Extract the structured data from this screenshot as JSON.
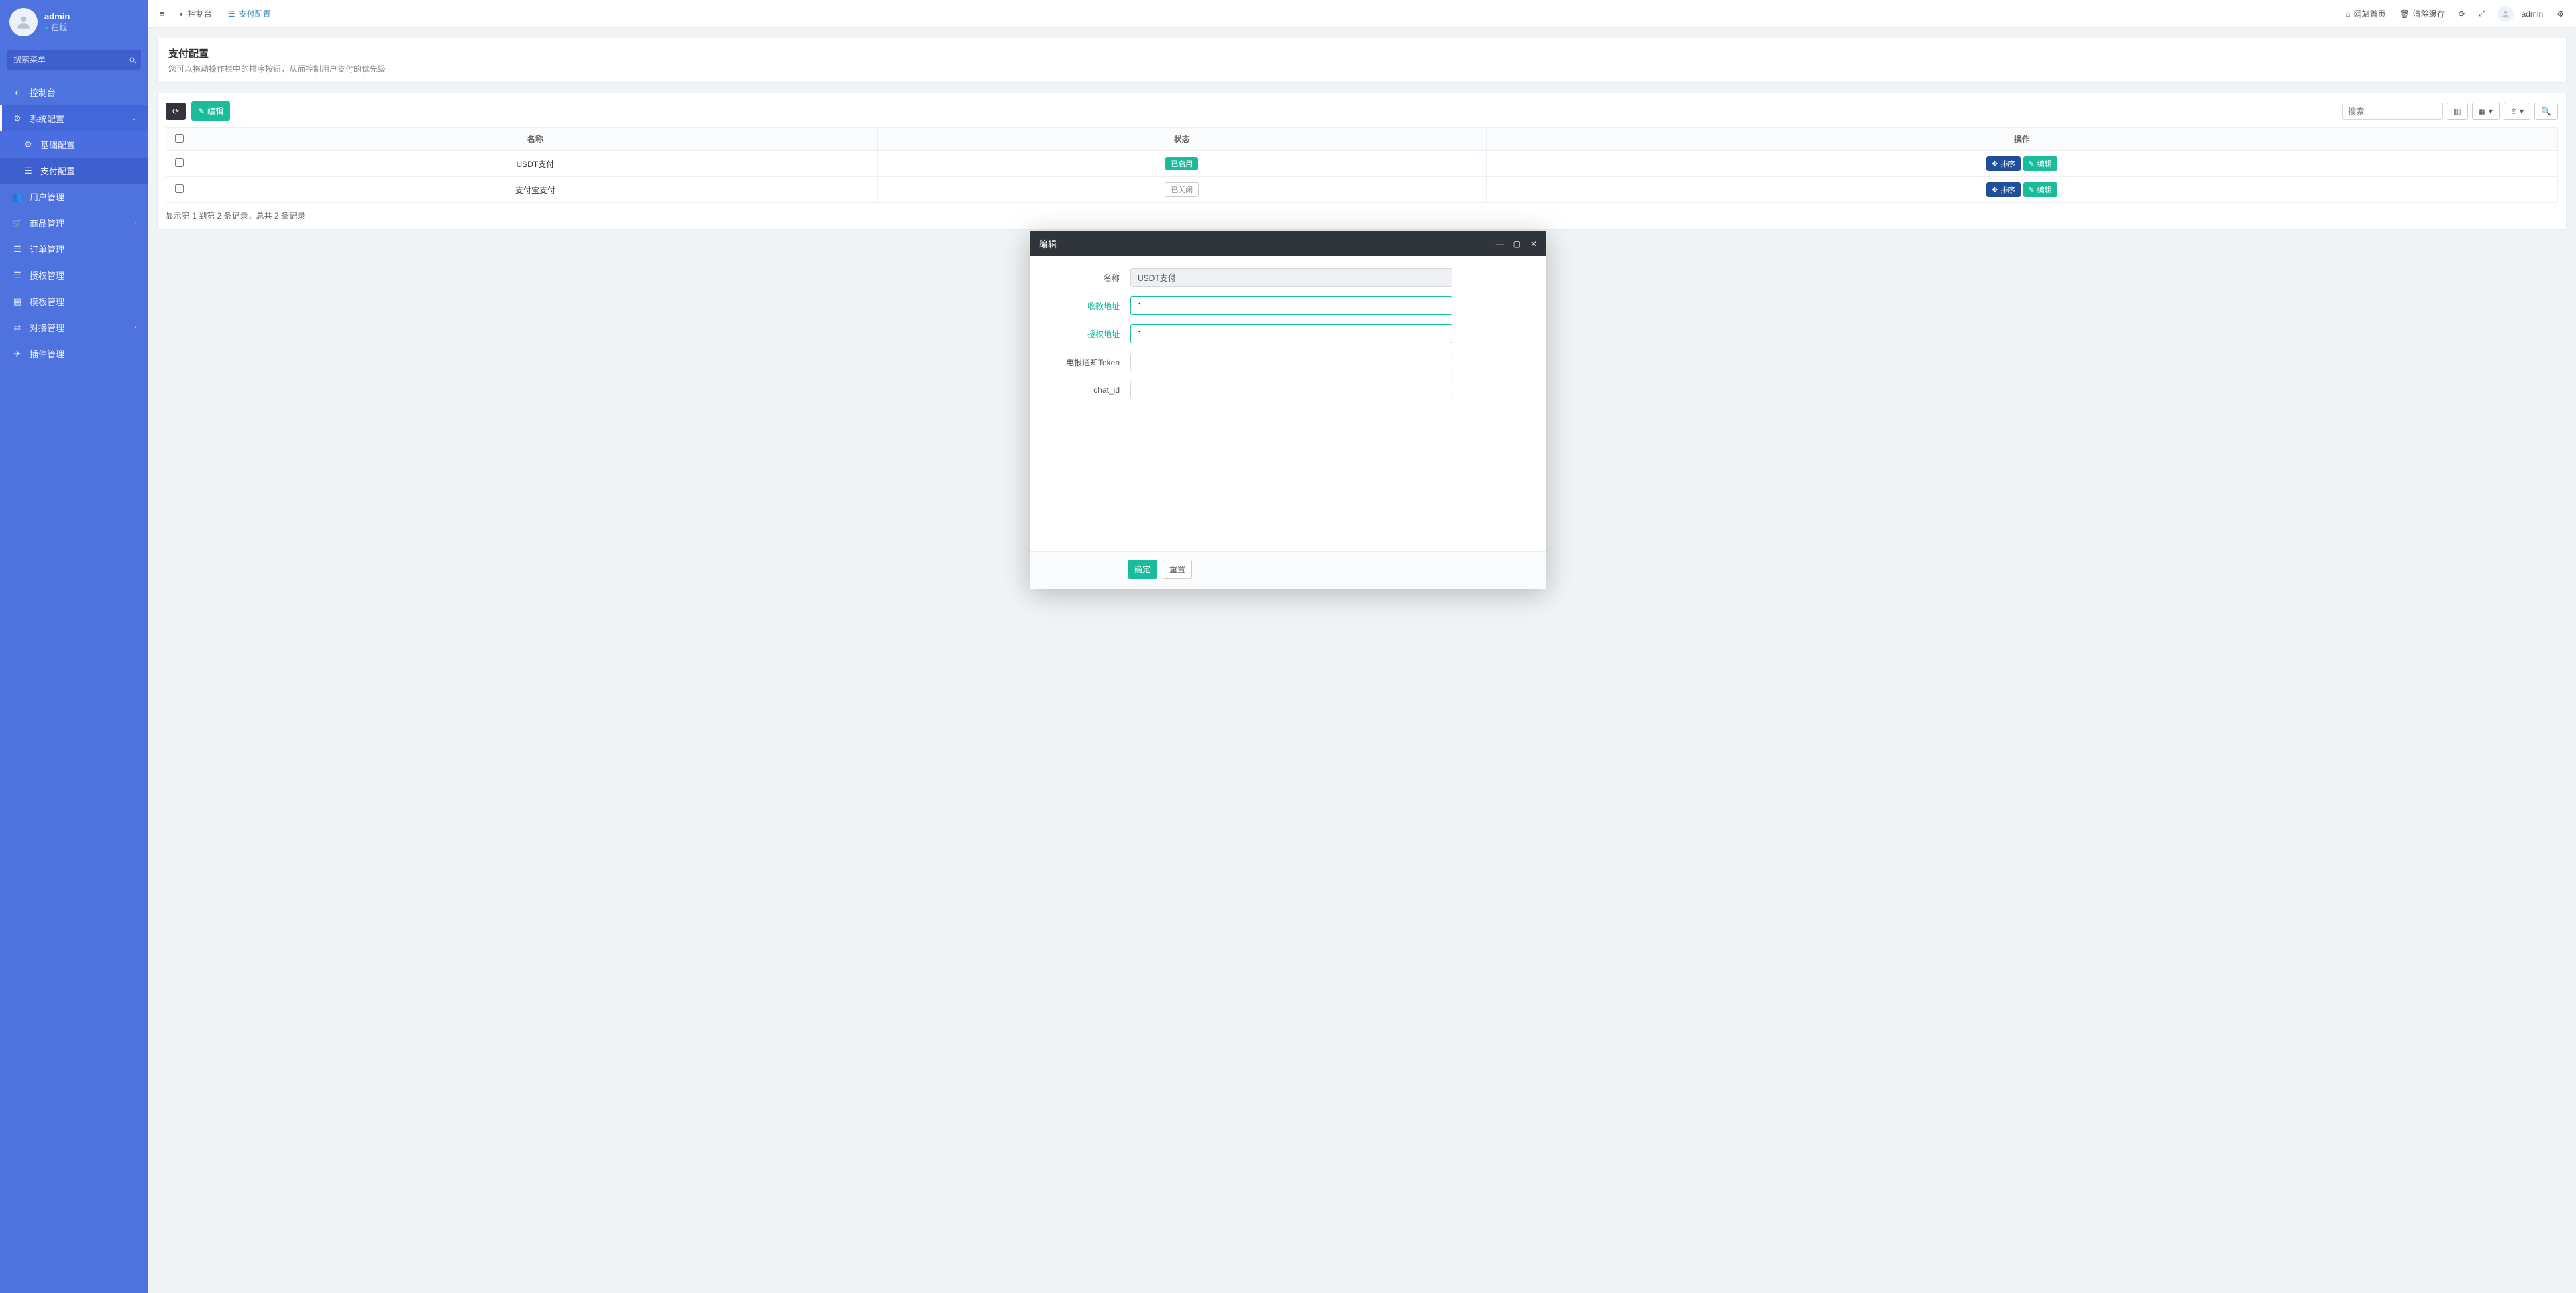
{
  "user": {
    "name": "admin",
    "status": "在线"
  },
  "search_placeholder": "搜索菜单",
  "menu": {
    "dashboard": "控制台",
    "system": "系统配置",
    "basic": "基础配置",
    "payment": "支付配置",
    "users": "用户管理",
    "goods": "商品管理",
    "orders": "订单管理",
    "auth": "授权管理",
    "template": "模板管理",
    "integrate": "对接管理",
    "plugins": "插件管理"
  },
  "tabs": {
    "dashboard": "控制台",
    "payment": "支付配置"
  },
  "topbar": {
    "home": "网站首页",
    "clear_cache": "清除缓存",
    "username": "admin"
  },
  "page": {
    "title": "支付配置",
    "subtitle": "您可以拖动操作栏中的排序按钮，从而控制用户支付的优先级"
  },
  "toolbar": {
    "edit": "编辑",
    "search_placeholder": "搜索"
  },
  "table": {
    "col_name": "名称",
    "col_status": "状态",
    "col_action": "操作",
    "rows": [
      {
        "name": "USDT支付",
        "status_label": "已启用",
        "status_on": true
      },
      {
        "name": "支付宝支付",
        "status_label": "已关闭",
        "status_on": false
      }
    ],
    "action_sort": "排序",
    "action_edit": "编辑",
    "pager": "显示第 1 到第 2 条记录，总共 2 条记录"
  },
  "modal": {
    "title": "编辑",
    "f_name": "名称",
    "f_name_val": "USDT支付",
    "f_recv": "收款地址",
    "f_recv_val": "1",
    "f_auth": "授权地址",
    "f_auth_val": "1",
    "f_token": "电报通知Token",
    "f_token_val": "",
    "f_chat": "chat_id",
    "f_chat_val": "",
    "btn_ok": "确定",
    "btn_reset": "重置"
  }
}
